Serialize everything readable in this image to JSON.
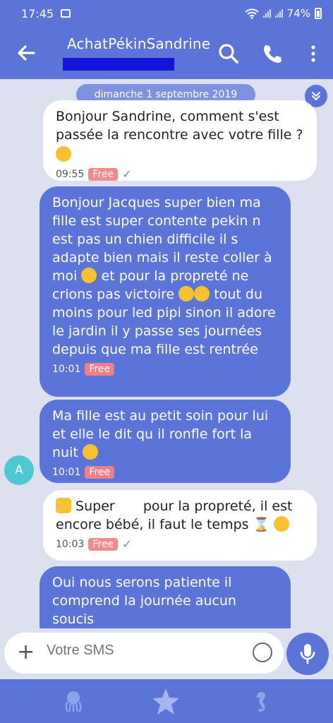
{
  "status_bar": {
    "time": "17:45",
    "battery": "74%"
  },
  "header": {
    "title": "AchatPékinSandrine"
  },
  "date_chip": "dimanche 1 septembre 2019",
  "messages": [
    {
      "text": "Bonjour Sandrine, comment s'est passée la rencontre avec votre fille ?",
      "time": "09:55",
      "badge": "Free",
      "direction": "outgoing"
    },
    {
      "text": "Bonjour Jacques super bien ma fille est super contente pekin n est pas un chien difficile il s adapte bien mais il reste coller à moi",
      "text2": "et pour la propreté ne crions pas victoire",
      "text3": "tout du moins pour led pipi sinon il adore le jardin il y passe ses journées depuis que ma fille est rentrée",
      "time": "10:01",
      "badge": "Free",
      "direction": "incoming"
    },
    {
      "text": "Ma fille est au petit soin pour lui et elle le dit qu il ronfle fort la nuit",
      "time": "10:01",
      "badge": "Free",
      "direction": "incoming"
    },
    {
      "text": "Super",
      "text2": "pour la propreté, il est encore bébé, il faut le temps",
      "time": "10:03",
      "badge": "Free",
      "direction": "outgoing"
    },
    {
      "text": "Oui nous serons patiente il comprend la journée aucun soucis",
      "direction": "incoming"
    }
  ],
  "avatar_letter": "A",
  "composer": {
    "placeholder": "Votre SMS"
  },
  "colors": {
    "primary": "#5b74d8",
    "background": "#dde1ef",
    "badge": "#f28b8b",
    "avatar": "#4ec9d4"
  }
}
